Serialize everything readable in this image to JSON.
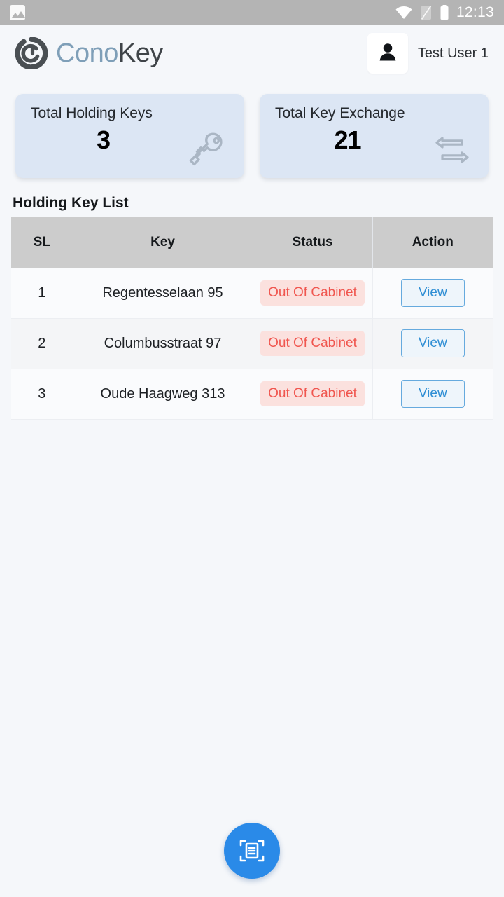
{
  "statusbar": {
    "time": "12:13",
    "icons": [
      "photo-icon",
      "wifi-icon",
      "signal-off-icon",
      "battery-icon"
    ]
  },
  "header": {
    "brand_first": "Cono",
    "brand_second": "Key",
    "logo_icon": "conokey-logo-icon",
    "avatar_icon": "person-icon",
    "user_name": "Test User 1"
  },
  "cards": [
    {
      "title": "Total Holding Keys",
      "value": "3",
      "icon": "key-icon"
    },
    {
      "title": "Total Key Exchange",
      "value": "21",
      "icon": "exchange-arrows-icon"
    }
  ],
  "list": {
    "section_title": "Holding Key List",
    "columns": [
      "SL",
      "Key",
      "Status",
      "Action"
    ],
    "rows": [
      {
        "sl": "1",
        "key": "Regentesselaan 95",
        "status": "Out Of Cabinet",
        "action": "View"
      },
      {
        "sl": "2",
        "key": "Columbusstraat 97",
        "status": "Out Of Cabinet",
        "action": "View"
      },
      {
        "sl": "3",
        "key": "Oude Haagweg 313",
        "status": "Out Of Cabinet",
        "action": "View"
      }
    ]
  },
  "fab": {
    "icon": "scan-document-icon"
  },
  "colors": {
    "page_bg": "#f5f7fa",
    "statusbar_bg": "#b4b4b4",
    "card_bg": "#dce6f4",
    "brand_accent": "#7f9fb8",
    "status_text": "#f0564f",
    "status_bg": "#fbe1de",
    "action_accent": "#2f8ed4",
    "fab_bg": "#2a8ae8",
    "table_header_bg": "#cccccc"
  }
}
